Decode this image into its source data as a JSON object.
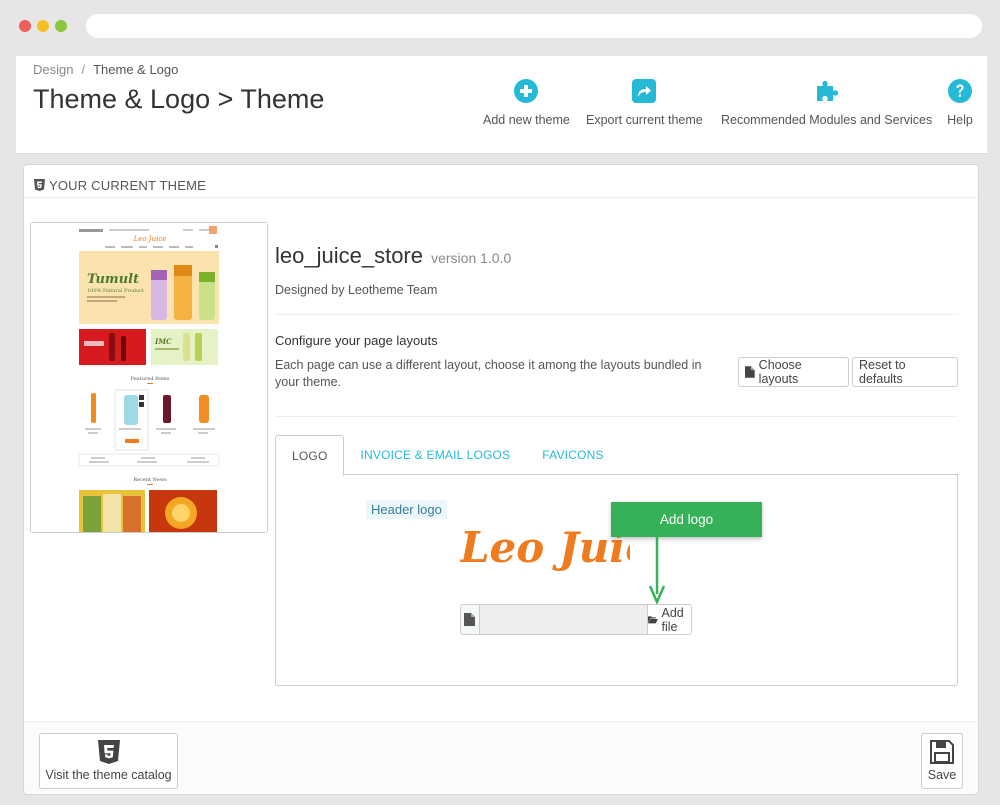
{
  "breadcrumb": {
    "parent": "Design",
    "current": "Theme & Logo"
  },
  "page": {
    "title": "Theme & Logo > Theme"
  },
  "toolbar": {
    "add_new_theme": "Add new theme",
    "export_current_theme": "Export current theme",
    "recommended": "Recommended Modules and Services",
    "help": "Help"
  },
  "panel": {
    "heading": "YOUR CURRENT THEME"
  },
  "theme": {
    "name": "leo_juice_store",
    "version": "version 1.0.0",
    "designed_by": "Designed by Leotheme Team",
    "configure_title": "Configure your page layouts",
    "configure_desc": "Each page can use a different layout, choose it among the layouts bundled in your theme.",
    "choose_layouts": "Choose layouts",
    "reset_defaults": "Reset to defaults"
  },
  "tabs": [
    {
      "label": "LOGO",
      "active": true
    },
    {
      "label": "INVOICE & EMAIL LOGOS",
      "active": false
    },
    {
      "label": "FAVICONS",
      "active": false
    }
  ],
  "logo_tab": {
    "header_logo_label": "Header logo",
    "logo_text": "Leo Juice",
    "callout": "Add logo",
    "add_file": "Add file",
    "file_value": ""
  },
  "preview": {
    "brand": "Leo Juice",
    "banner_title": "Tumult",
    "banner_sub": "100% Natural Product",
    "featured": "Featured Items",
    "recent": "Recent News"
  },
  "footer": {
    "catalog": "Visit the theme catalog",
    "save": "Save"
  },
  "colors": {
    "accent": "#25b9d7",
    "green": "#35b158",
    "logo_orange": "#f07a1e"
  }
}
